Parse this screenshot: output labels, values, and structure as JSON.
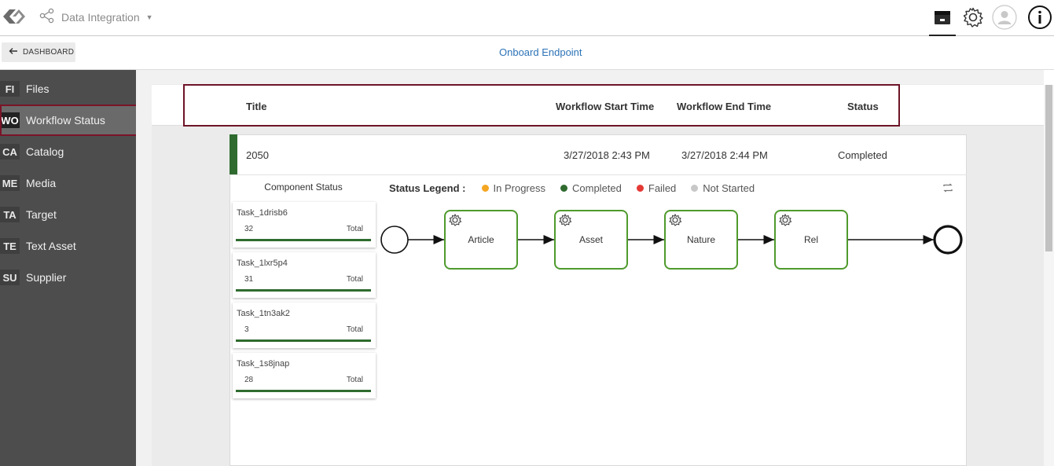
{
  "app": {
    "title": "Data Integration"
  },
  "subbar": {
    "back_label": "DASHBOARD",
    "link": "Onboard Endpoint"
  },
  "sidebar": {
    "items": [
      {
        "abbr": "FI",
        "label": "Files"
      },
      {
        "abbr": "WO",
        "label": "Workflow Status"
      },
      {
        "abbr": "CA",
        "label": "Catalog"
      },
      {
        "abbr": "ME",
        "label": "Media"
      },
      {
        "abbr": "TA",
        "label": "Target"
      },
      {
        "abbr": "TE",
        "label": "Text Asset"
      },
      {
        "abbr": "SU",
        "label": "Supplier"
      }
    ],
    "active_index": 1
  },
  "table": {
    "headers": {
      "title": "Title",
      "start": "Workflow Start Time",
      "end": "Workflow End Time",
      "status": "Status"
    },
    "row": {
      "title": "2050",
      "start": "3/27/2018 2:43 PM",
      "end": "3/27/2018 2:44 PM",
      "status": "Completed"
    }
  },
  "components": {
    "title": "Component Status",
    "tasks": [
      {
        "name": "Task_1drisb6",
        "count": "32",
        "total_label": "Total"
      },
      {
        "name": "Task_1lxr5p4",
        "count": "31",
        "total_label": "Total"
      },
      {
        "name": "Task_1tn3ak2",
        "count": "3",
        "total_label": "Total"
      },
      {
        "name": "Task_1s8jnap",
        "count": "28",
        "total_label": "Total"
      }
    ]
  },
  "legend": {
    "title": "Status Legend :",
    "items": [
      {
        "label": "In Progress",
        "color": "#f5a623"
      },
      {
        "label": "Completed",
        "color": "#2f6b2f"
      },
      {
        "label": "Failed",
        "color": "#e53935"
      },
      {
        "label": "Not Started",
        "color": "#c8c8c8"
      }
    ]
  },
  "workflow": {
    "nodes": [
      "Article",
      "Asset",
      "Nature",
      "Rel"
    ],
    "node_color": "#4f9a2d"
  },
  "colors": {
    "accent": "#6d1428",
    "link": "#2d73b7",
    "sidebar": "#4d4d4d",
    "complete": "#2f6b2f"
  },
  "icons": {
    "logo": "logo-icon",
    "app_switch": "share-nodes-icon",
    "store": "box-icon",
    "settings": "gear-icon",
    "user": "avatar-icon",
    "info": "info-icon",
    "back": "arrow-left-icon",
    "refresh": "refresh-icon",
    "task_node": "gears-icon"
  }
}
